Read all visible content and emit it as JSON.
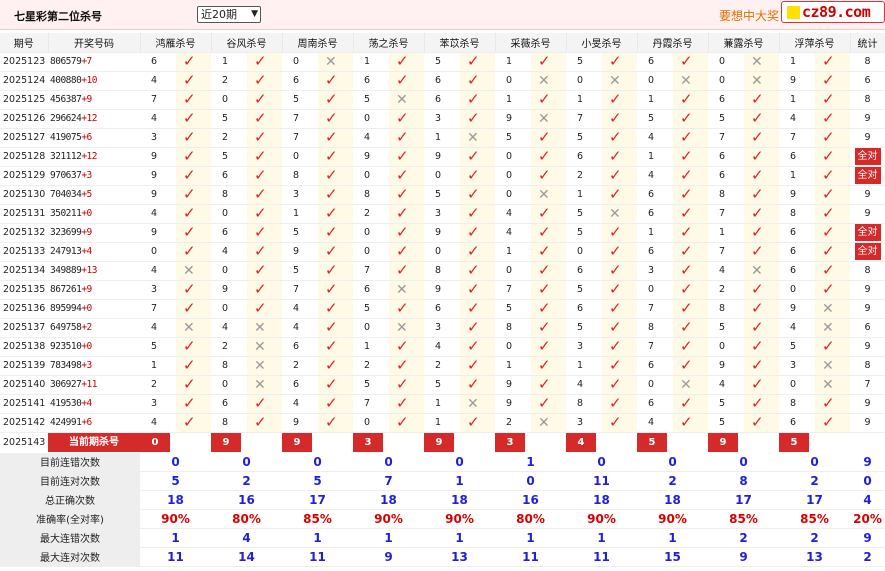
{
  "header": {
    "title": "七星彩第二位杀号",
    "period_select": "近20期",
    "promo": "要想中大奖",
    "logo": "cz89.com"
  },
  "columns": [
    "期号",
    "开奖号码",
    "鸿雁杀号",
    "谷风杀号",
    "周南杀号",
    "荡之杀号",
    "苯苡杀号",
    "采薇杀号",
    "小旻杀号",
    "丹霞杀号",
    "蒹露杀号",
    "浮萍杀号",
    "统计"
  ],
  "rows": [
    {
      "issue": "2025123",
      "draw": "806579",
      "diff": "+7",
      "kills": [
        "6",
        "1",
        "0",
        "1",
        "5",
        "1",
        "5",
        "6",
        "0",
        "1"
      ],
      "res": [
        "y",
        "y",
        "n",
        "y",
        "y",
        "y",
        "y",
        "y",
        "n",
        "y"
      ],
      "stat": "8"
    },
    {
      "issue": "2025124",
      "draw": "400880",
      "diff": "+10",
      "kills": [
        "4",
        "2",
        "6",
        "6",
        "6",
        "0",
        "0",
        "0",
        "0",
        "9"
      ],
      "res": [
        "y",
        "y",
        "y",
        "y",
        "y",
        "n",
        "n",
        "n",
        "n",
        "y"
      ],
      "stat": "6"
    },
    {
      "issue": "2025125",
      "draw": "456387",
      "diff": "+9",
      "kills": [
        "7",
        "0",
        "5",
        "5",
        "6",
        "1",
        "1",
        "1",
        "6",
        "1"
      ],
      "res": [
        "y",
        "y",
        "y",
        "n",
        "y",
        "y",
        "y",
        "y",
        "y",
        "y"
      ],
      "stat": "8"
    },
    {
      "issue": "2025126",
      "draw": "296624",
      "diff": "+12",
      "kills": [
        "4",
        "5",
        "7",
        "0",
        "3",
        "9",
        "7",
        "5",
        "5",
        "4"
      ],
      "res": [
        "y",
        "y",
        "y",
        "y",
        "y",
        "n",
        "y",
        "y",
        "y",
        "y"
      ],
      "stat": "9"
    },
    {
      "issue": "2025127",
      "draw": "419075",
      "diff": "+6",
      "kills": [
        "3",
        "2",
        "7",
        "4",
        "1",
        "5",
        "5",
        "4",
        "7",
        "7"
      ],
      "res": [
        "y",
        "y",
        "y",
        "y",
        "n",
        "y",
        "y",
        "y",
        "y",
        "y"
      ],
      "stat": "9"
    },
    {
      "issue": "2025128",
      "draw": "321112",
      "diff": "+12",
      "kills": [
        "9",
        "5",
        "0",
        "9",
        "9",
        "0",
        "6",
        "1",
        "6",
        "6"
      ],
      "res": [
        "y",
        "y",
        "y",
        "y",
        "y",
        "y",
        "y",
        "y",
        "y",
        "y"
      ],
      "stat": "全对"
    },
    {
      "issue": "2025129",
      "draw": "970637",
      "diff": "+3",
      "kills": [
        "9",
        "6",
        "8",
        "0",
        "0",
        "0",
        "2",
        "4",
        "6",
        "1"
      ],
      "res": [
        "y",
        "y",
        "y",
        "y",
        "y",
        "y",
        "y",
        "y",
        "y",
        "y"
      ],
      "stat": "全对"
    },
    {
      "issue": "2025130",
      "draw": "704034",
      "diff": "+5",
      "kills": [
        "9",
        "8",
        "3",
        "8",
        "5",
        "0",
        "1",
        "6",
        "8",
        "9"
      ],
      "res": [
        "y",
        "y",
        "y",
        "y",
        "y",
        "n",
        "y",
        "y",
        "y",
        "y"
      ],
      "stat": "9"
    },
    {
      "issue": "2025131",
      "draw": "350211",
      "diff": "+0",
      "kills": [
        "4",
        "0",
        "1",
        "2",
        "3",
        "4",
        "5",
        "6",
        "7",
        "8"
      ],
      "res": [
        "y",
        "y",
        "y",
        "y",
        "y",
        "y",
        "n",
        "y",
        "y",
        "y"
      ],
      "stat": "9"
    },
    {
      "issue": "2025132",
      "draw": "323699",
      "diff": "+9",
      "kills": [
        "9",
        "6",
        "5",
        "0",
        "9",
        "4",
        "5",
        "1",
        "1",
        "6"
      ],
      "res": [
        "y",
        "y",
        "y",
        "y",
        "y",
        "y",
        "y",
        "y",
        "y",
        "y"
      ],
      "stat": "全对"
    },
    {
      "issue": "2025133",
      "draw": "247913",
      "diff": "+4",
      "kills": [
        "0",
        "4",
        "9",
        "0",
        "0",
        "1",
        "0",
        "6",
        "7",
        "6"
      ],
      "res": [
        "y",
        "y",
        "y",
        "y",
        "y",
        "y",
        "y",
        "y",
        "y",
        "y"
      ],
      "stat": "全对"
    },
    {
      "issue": "2025134",
      "draw": "349889",
      "diff": "+13",
      "kills": [
        "4",
        "0",
        "5",
        "7",
        "8",
        "0",
        "6",
        "3",
        "4",
        "6"
      ],
      "res": [
        "n",
        "y",
        "y",
        "y",
        "y",
        "y",
        "y",
        "y",
        "n",
        "y"
      ],
      "stat": "8"
    },
    {
      "issue": "2025135",
      "draw": "867261",
      "diff": "+9",
      "kills": [
        "3",
        "9",
        "7",
        "6",
        "9",
        "7",
        "5",
        "0",
        "2",
        "0"
      ],
      "res": [
        "y",
        "y",
        "y",
        "n",
        "y",
        "y",
        "y",
        "y",
        "y",
        "y"
      ],
      "stat": "9"
    },
    {
      "issue": "2025136",
      "draw": "895994",
      "diff": "+0",
      "kills": [
        "7",
        "0",
        "4",
        "5",
        "6",
        "5",
        "6",
        "7",
        "8",
        "9"
      ],
      "res": [
        "y",
        "y",
        "y",
        "y",
        "y",
        "y",
        "y",
        "y",
        "y",
        "n"
      ],
      "stat": "9"
    },
    {
      "issue": "2025137",
      "draw": "649758",
      "diff": "+2",
      "kills": [
        "4",
        "4",
        "4",
        "0",
        "3",
        "8",
        "5",
        "8",
        "5",
        "4"
      ],
      "res": [
        "n",
        "n",
        "y",
        "n",
        "y",
        "y",
        "y",
        "y",
        "y",
        "n"
      ],
      "stat": "6"
    },
    {
      "issue": "2025138",
      "draw": "923510",
      "diff": "+0",
      "kills": [
        "5",
        "2",
        "6",
        "1",
        "4",
        "0",
        "3",
        "7",
        "0",
        "5"
      ],
      "res": [
        "y",
        "n",
        "y",
        "y",
        "y",
        "y",
        "y",
        "y",
        "y",
        "y"
      ],
      "stat": "9"
    },
    {
      "issue": "2025139",
      "draw": "783498",
      "diff": "+3",
      "kills": [
        "1",
        "8",
        "2",
        "2",
        "2",
        "1",
        "1",
        "6",
        "9",
        "3"
      ],
      "res": [
        "y",
        "n",
        "y",
        "y",
        "y",
        "y",
        "y",
        "y",
        "y",
        "n"
      ],
      "stat": "8"
    },
    {
      "issue": "2025140",
      "draw": "306927",
      "diff": "+11",
      "kills": [
        "2",
        "0",
        "6",
        "5",
        "5",
        "9",
        "4",
        "0",
        "4",
        "0"
      ],
      "res": [
        "y",
        "n",
        "y",
        "y",
        "y",
        "y",
        "y",
        "n",
        "y",
        "n"
      ],
      "stat": "7"
    },
    {
      "issue": "2025141",
      "draw": "419530",
      "diff": "+4",
      "kills": [
        "3",
        "6",
        "4",
        "7",
        "1",
        "9",
        "8",
        "6",
        "5",
        "8"
      ],
      "res": [
        "y",
        "y",
        "y",
        "y",
        "n",
        "y",
        "y",
        "y",
        "y",
        "y"
      ],
      "stat": "9"
    },
    {
      "issue": "2025142",
      "draw": "424991",
      "diff": "+6",
      "kills": [
        "4",
        "8",
        "9",
        "0",
        "1",
        "2",
        "3",
        "4",
        "5",
        "6"
      ],
      "res": [
        "y",
        "y",
        "y",
        "y",
        "y",
        "n",
        "y",
        "y",
        "y",
        "y"
      ],
      "stat": "9"
    }
  ],
  "current": {
    "issue": "2025143",
    "label": "当前期杀号",
    "kills": [
      "0",
      "9",
      "9",
      "3",
      "9",
      "3",
      "4",
      "5",
      "9",
      "5"
    ]
  },
  "stats": [
    {
      "label": "目前连错次数",
      "values": [
        "0",
        "0",
        "0",
        "0",
        "0",
        "1",
        "0",
        "0",
        "0",
        "0",
        "9"
      ]
    },
    {
      "label": "目前连对次数",
      "values": [
        "5",
        "2",
        "5",
        "7",
        "1",
        "0",
        "11",
        "2",
        "8",
        "2",
        "0"
      ]
    },
    {
      "label": "总正确次数",
      "values": [
        "18",
        "16",
        "17",
        "18",
        "18",
        "16",
        "18",
        "18",
        "17",
        "17",
        "4"
      ]
    },
    {
      "label": "准确率(全对率)",
      "values": [
        "90%",
        "80%",
        "85%",
        "90%",
        "90%",
        "80%",
        "90%",
        "90%",
        "85%",
        "85%",
        "20%"
      ]
    },
    {
      "label": "最大连错次数",
      "values": [
        "1",
        "4",
        "1",
        "1",
        "1",
        "1",
        "1",
        "1",
        "2",
        "2",
        "9"
      ]
    },
    {
      "label": "最大连对次数",
      "values": [
        "11",
        "14",
        "11",
        "9",
        "13",
        "11",
        "11",
        "15",
        "9",
        "13",
        "2"
      ]
    }
  ],
  "stat_colors": [
    "blue",
    "blue",
    "blue",
    "red",
    "blue",
    "blue"
  ],
  "icons": {
    "correct": "check-icon",
    "wrong": "cross-icon"
  },
  "colors": {
    "accent": "#d42a2a",
    "highlight": "#fffae6"
  }
}
